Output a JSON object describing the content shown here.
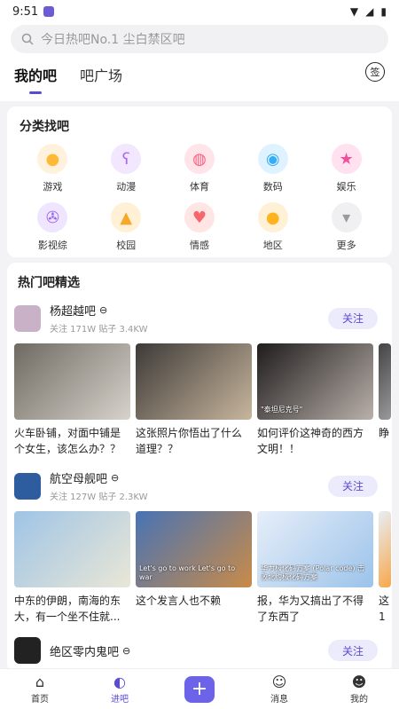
{
  "status": {
    "time": "9:51",
    "battery_icon": "battery-icon",
    "wifi_icon": "wifi-icon"
  },
  "search": {
    "placeholder": "今日热吧No.1 尘白禁区吧"
  },
  "tabs": [
    {
      "label": "我的吧",
      "active": true
    },
    {
      "label": "吧广场",
      "active": false
    }
  ],
  "sign_in": {
    "label": "签"
  },
  "categories": {
    "title": "分类找吧",
    "items": [
      {
        "label": "游戏",
        "icon": "gamepad-icon",
        "color": "#ffb936",
        "bg": "#fff2dc"
      },
      {
        "label": "动漫",
        "icon": "bear-icon",
        "color": "#a86bf0",
        "bg": "#f2e7fe"
      },
      {
        "label": "体育",
        "icon": "ball-icon",
        "color": "#fb5d7d",
        "bg": "#ffe4ea"
      },
      {
        "label": "数码",
        "icon": "camera-icon",
        "color": "#35aef6",
        "bg": "#def3ff"
      },
      {
        "label": "娱乐",
        "icon": "star-icon",
        "color": "#f24f9b",
        "bg": "#ffe1ef"
      },
      {
        "label": "影视综",
        "icon": "film-icon",
        "color": "#9a63ef",
        "bg": "#efe5ff"
      },
      {
        "label": "校园",
        "icon": "graduation-cap-icon",
        "color": "#f7a829",
        "bg": "#fff0d6"
      },
      {
        "label": "情感",
        "icon": "heart-icon",
        "color": "#f6676c",
        "bg": "#ffe6e4"
      },
      {
        "label": "地区",
        "icon": "location-pin-icon",
        "color": "#ffb41f",
        "bg": "#fff1d5"
      },
      {
        "label": "更多",
        "icon": "chevron-down-icon",
        "color": "#9a9a9a",
        "bg": "#f0f0f2"
      }
    ]
  },
  "hot": {
    "title": "热门吧精选",
    "groups": [
      {
        "name": "杨超越吧",
        "stats": "关注 171W   贴子 3.4KW",
        "follow": "关注",
        "avatar_color": "#c9b2c8",
        "posts": [
          {
            "text": "火车卧铺，对面中铺是个女生，该怎么办？？",
            "c1": "#6f6a61",
            "c2": "#d7d3cc"
          },
          {
            "text": "这张照片你悟出了什么道理？？",
            "c1": "#3d3a38",
            "c2": "#c8b69d"
          },
          {
            "text": "如何评价这神奇的西方文明！！",
            "c1": "#1f1c1c",
            "c2": "#b9b0aa",
            "caption": "\"泰坦尼克号\""
          },
          {
            "text": "睁",
            "c1": "#444",
            "c2": "#999",
            "partial": true
          }
        ]
      },
      {
        "name": "航空母舰吧",
        "stats": "关注 127W   贴子 2.3KW",
        "follow": "关注",
        "avatar_color": "#2d5d9e",
        "posts": [
          {
            "text": "中东的伊朗，南海的东大，有一个坐不住就...",
            "c1": "#9fc4e6",
            "c2": "#e9e7d6"
          },
          {
            "text": "这个发言人也不赖",
            "c1": "#4873b5",
            "c2": "#c98b48",
            "caption": "Let's go to work    Let's go to war"
          },
          {
            "text": "报，华为又搞出了不得了东西了",
            "c1": "#e6eef9",
            "c2": "#9cc3ea",
            "caption": "华为极化码方案 (Polar code)  击败北约极化码方案"
          },
          {
            "text": "这1",
            "c1": "#e8eef6",
            "c2": "#f7a74b",
            "partial": true
          }
        ]
      },
      {
        "name": "绝区零内鬼吧",
        "stats": "",
        "follow": "关注",
        "avatar_color": "#222",
        "posts": []
      }
    ]
  },
  "nav": [
    {
      "label": "首页",
      "icon": "home-icon",
      "glyph": "⌂",
      "active": false
    },
    {
      "label": "进吧",
      "icon": "bar-icon",
      "glyph": "◐",
      "active": true
    },
    {
      "label": "",
      "icon": "plus-icon",
      "glyph": "+",
      "active": false,
      "plus": true
    },
    {
      "label": "消息",
      "icon": "message-icon",
      "glyph": "☺",
      "active": false
    },
    {
      "label": "我的",
      "icon": "profile-icon",
      "glyph": "☻",
      "active": false
    }
  ]
}
